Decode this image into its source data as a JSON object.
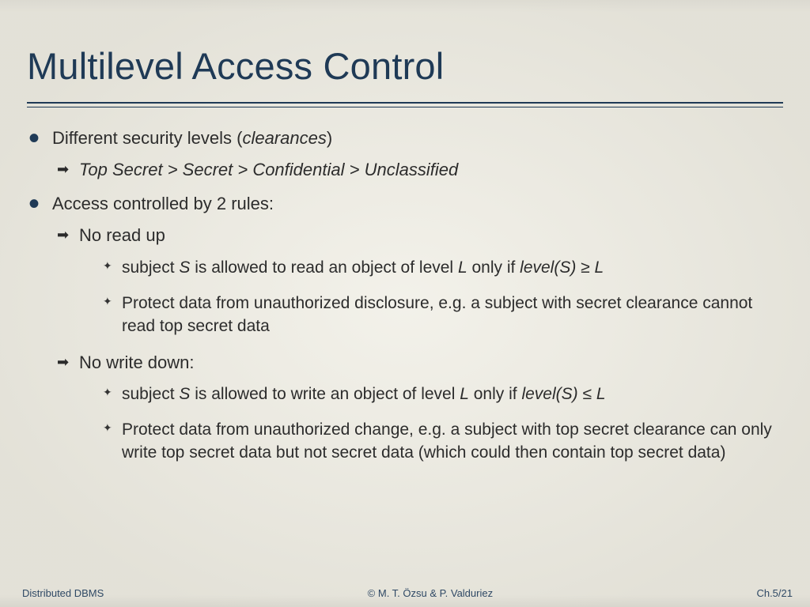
{
  "title": "Multilevel Access Control",
  "bullets": {
    "b1": {
      "text_pre": "Different security levels (",
      "text_em": "clearances",
      "text_post": ")",
      "sub1": "Top Secret > Secret > Confidential > Unclassified"
    },
    "b2": {
      "text": "Access controlled by 2 rules:",
      "rule1": {
        "title": "No read up",
        "p1_pre": "subject ",
        "p1_s": "S",
        "p1_mid": " is allowed to read an object of level ",
        "p1_l": "L",
        "p1_mid2": " only if ",
        "p1_levels": "level(S)",
        "p1_op": " ≥ ",
        "p1_l2": "L",
        "p2": "Protect data from unauthorized disclosure, e.g. a subject with secret clearance cannot read top secret data"
      },
      "rule2": {
        "title": "No write down:",
        "p1_pre": "subject ",
        "p1_s": "S",
        "p1_mid": " is allowed to write an object of level ",
        "p1_l": "L",
        "p1_mid2": " only if ",
        "p1_levels": "level(S)",
        "p1_op": " ≤ ",
        "p1_l2": "L",
        "p2": "Protect data from unauthorized change, e.g. a subject with top secret clearance can only write top secret data but not secret data (which could then contain top secret data)"
      }
    }
  },
  "footer": {
    "left": "Distributed DBMS",
    "center": "© M. T. Özsu & P. Valduriez",
    "right": "Ch.5/21"
  }
}
